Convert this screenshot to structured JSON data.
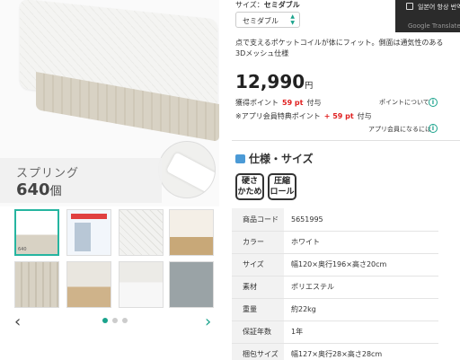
{
  "gallery": {
    "spring_label": "スプリング",
    "spring_count": "640",
    "spring_unit": "個",
    "thumbnails": [
      {
        "name": "mattress-thumb",
        "active": true
      },
      {
        "name": "spec-sheet-thumb",
        "active": false
      },
      {
        "name": "quilt-closeup-thumb",
        "active": false
      },
      {
        "name": "bed-frame-thumb",
        "active": false
      },
      {
        "name": "side-fabric-thumb",
        "active": false
      },
      {
        "name": "room-scene-thumb",
        "active": false
      },
      {
        "name": "bedroom-thumb",
        "active": false
      },
      {
        "name": "mesh-closeup-thumb",
        "active": false
      }
    ],
    "prev_icon": "chevron-left-icon",
    "next_icon": "chevron-right-icon",
    "page_dots": 3,
    "active_dot": 0,
    "thumb_first_label": "640"
  },
  "product": {
    "size_label": "サイズ：",
    "size_value": "セミダブル",
    "size_select_value": "セミダブル",
    "description": "点で支えるポケットコイルが体にフィット。側面は通気性のある3Dメッシュ仕様",
    "price": "12,990",
    "price_unit": "円",
    "points_label": "獲得ポイント",
    "points_value": "59 pt",
    "points_suffix": "付与",
    "points_link": "ポイントについて",
    "app_points_label": "※アプリ会員特典ポイント",
    "app_points_value": "+ 59 pt",
    "app_points_suffix": "付与",
    "app_member_link": "アプリ会員になるには"
  },
  "spec": {
    "title": "仕様・サイズ",
    "badges": [
      "硬さ\nかため",
      "圧縮\nロール"
    ],
    "badge_lines": [
      [
        "硬さ",
        "かため"
      ],
      [
        "圧縮",
        "ロール"
      ]
    ],
    "rows": [
      {
        "key": "商品コード",
        "value": "5651995"
      },
      {
        "key": "カラー",
        "value": "ホワイト"
      },
      {
        "key": "サイズ",
        "value": "幅120×奥行196×高さ20cm"
      },
      {
        "key": "素材",
        "value": "ポリエステル"
      },
      {
        "key": "重量",
        "value": "約22kg"
      },
      {
        "key": "保証年数",
        "value": "1年"
      },
      {
        "key": "梱包サイズ",
        "value": "幅127×奥行28×高さ28cm"
      }
    ]
  },
  "translate_popup": {
    "checkbox_label": "일본어 항상 번역",
    "footer": "Google Translate"
  },
  "colors": {
    "accent": "#1aa38c",
    "points_red": "#e02020"
  }
}
